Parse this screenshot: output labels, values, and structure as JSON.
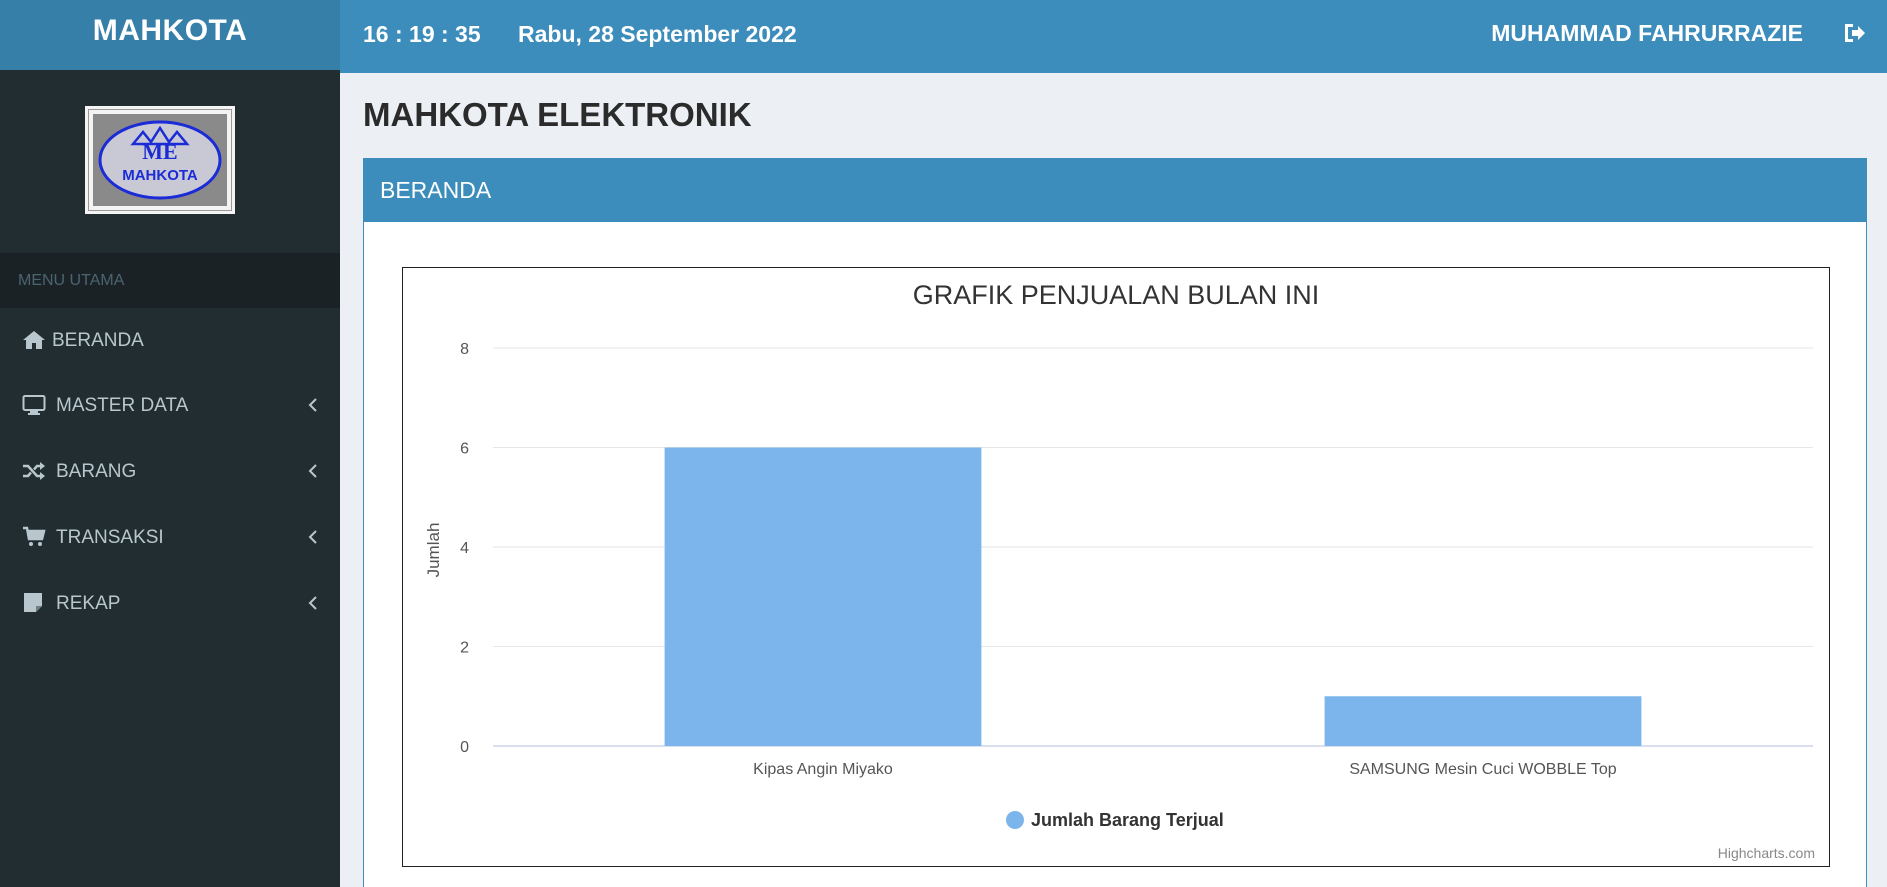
{
  "header": {
    "brand": "MAHKOTA",
    "time": "16 : 19 : 35",
    "date": "Rabu, 28 September 2022",
    "user": "MUHAMMAD FAHRURRAZIE"
  },
  "sidebar": {
    "logo_text": "MAHKOTA",
    "logo_monogram": "ME",
    "menu_header": "MENU UTAMA",
    "items": [
      {
        "label": "BERANDA",
        "icon": "home-icon"
      },
      {
        "label": "MASTER DATA",
        "icon": "desktop-icon"
      },
      {
        "label": "BARANG",
        "icon": "random-icon"
      },
      {
        "label": "TRANSAKSI",
        "icon": "cart-icon"
      },
      {
        "label": "REKAP",
        "icon": "note-icon"
      }
    ]
  },
  "main": {
    "page_title": "MAHKOTA ELEKTRONIK",
    "box_title": "BERANDA"
  },
  "colors": {
    "header": "#3c8dbc",
    "brand": "#367fa9",
    "sidebar": "#222d32",
    "bar": "#7cb5ec"
  },
  "chart_data": {
    "type": "bar",
    "title": "GRAFIK PENJUALAN BULAN INI",
    "categories": [
      "Kipas Angin Miyako",
      "SAMSUNG Mesin Cuci WOBBLE Top"
    ],
    "series": [
      {
        "name": "Jumlah Barang Terjual",
        "values": [
          6,
          1
        ]
      }
    ],
    "ylabel": "Jumlah",
    "xlabel": "",
    "ylim": [
      0,
      8
    ],
    "yticks": [
      0,
      2,
      4,
      6,
      8
    ],
    "grid": true,
    "legend": "bottom-center",
    "credits": "Highcharts.com"
  }
}
